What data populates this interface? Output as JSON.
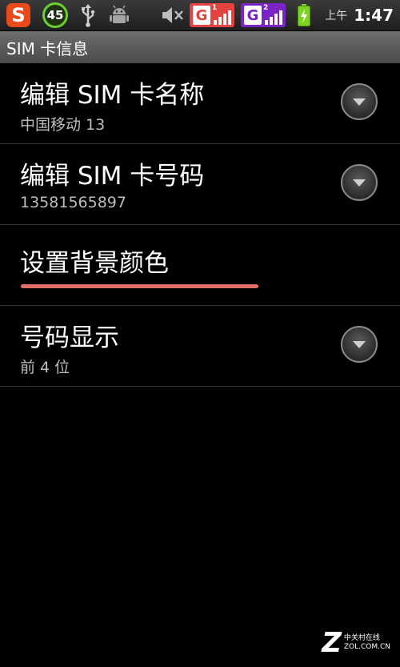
{
  "statusbar": {
    "badge_count": "45",
    "sim1_letter": "G",
    "sim1_num": "1",
    "sim2_letter": "G",
    "sim2_num": "2",
    "ampm": "上午",
    "time": "1:47",
    "colors": {
      "sim1": "#e5433f",
      "sim2": "#7a23c6",
      "battery": "#7ed321"
    }
  },
  "titlebar": {
    "title": "SIM 卡信息"
  },
  "list": {
    "items": [
      {
        "title": "编辑 SIM 卡名称",
        "subtitle": "中国移动 13"
      },
      {
        "title": "编辑 SIM 卡号码",
        "subtitle": "13581565897"
      },
      {
        "title": "设置背景颜色"
      },
      {
        "title": "号码显示",
        "subtitle": "前 4 位"
      }
    ]
  },
  "watermark": {
    "logo": "Z",
    "line1": "中关村在线",
    "line2": "ZOL.COM.CN"
  }
}
